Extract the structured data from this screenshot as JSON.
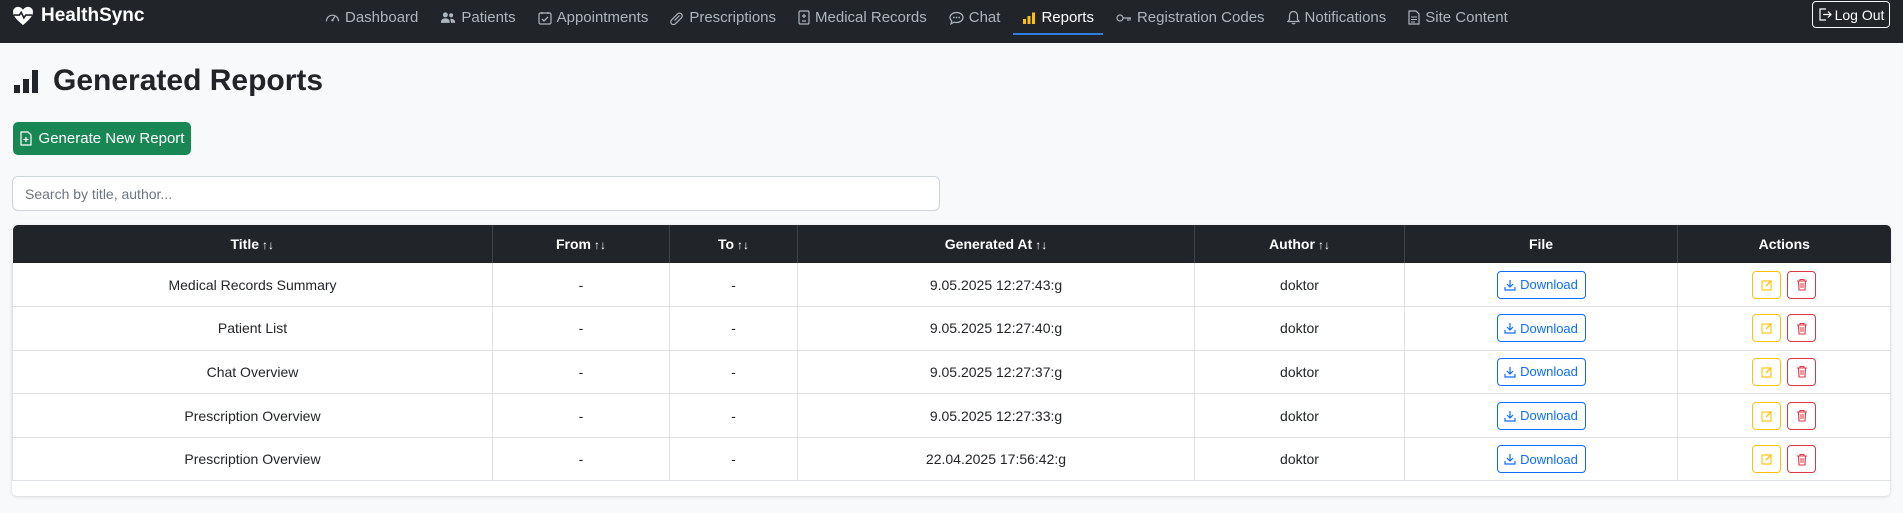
{
  "app": {
    "brand": "HealthSync"
  },
  "nav": {
    "items": [
      {
        "label": "Dashboard",
        "icon": "gauge-icon",
        "active": false
      },
      {
        "label": "Patients",
        "icon": "people-icon",
        "active": false
      },
      {
        "label": "Appointments",
        "icon": "calendar-check-icon",
        "active": false
      },
      {
        "label": "Prescriptions",
        "icon": "capsule-icon",
        "active": false
      },
      {
        "label": "Medical Records",
        "icon": "file-medical-icon",
        "active": false
      },
      {
        "label": "Chat",
        "icon": "chat-icon",
        "active": false
      },
      {
        "label": "Reports",
        "icon": "bar-chart-icon",
        "active": true
      },
      {
        "label": "Registration Codes",
        "icon": "key-icon",
        "active": false
      },
      {
        "label": "Notifications",
        "icon": "bell-icon",
        "active": false
      },
      {
        "label": "Site Content",
        "icon": "file-text-icon",
        "active": false
      }
    ],
    "logout_label": "Log Out"
  },
  "page": {
    "title": "Generated Reports",
    "generate_button": "Generate New Report",
    "search_placeholder": "Search by title, author..."
  },
  "table": {
    "headers": {
      "title": "Title",
      "from": "From",
      "to": "To",
      "generated_at": "Generated At",
      "author": "Author",
      "file": "File",
      "actions": "Actions"
    },
    "sort_glyph": "↑↓",
    "download_label": "Download",
    "rows": [
      {
        "title": "Medical Records Summary",
        "from": "-",
        "to": "-",
        "generated_at": "9.05.2025 12:27:43:g",
        "author": "doktor"
      },
      {
        "title": "Patient List",
        "from": "-",
        "to": "-",
        "generated_at": "9.05.2025 12:27:40:g",
        "author": "doktor"
      },
      {
        "title": "Chat Overview",
        "from": "-",
        "to": "-",
        "generated_at": "9.05.2025 12:27:37:g",
        "author": "doktor"
      },
      {
        "title": "Prescription Overview",
        "from": "-",
        "to": "-",
        "generated_at": "9.05.2025 12:27:33:g",
        "author": "doktor"
      },
      {
        "title": "Prescription Overview",
        "from": "-",
        "to": "-",
        "generated_at": "22.04.2025 17:56:42:g",
        "author": "doktor"
      }
    ]
  },
  "colors": {
    "navbar": "#212529",
    "success": "#198754",
    "primary": "#0d6efd",
    "warning": "#ffc107",
    "danger": "#dc3545"
  }
}
